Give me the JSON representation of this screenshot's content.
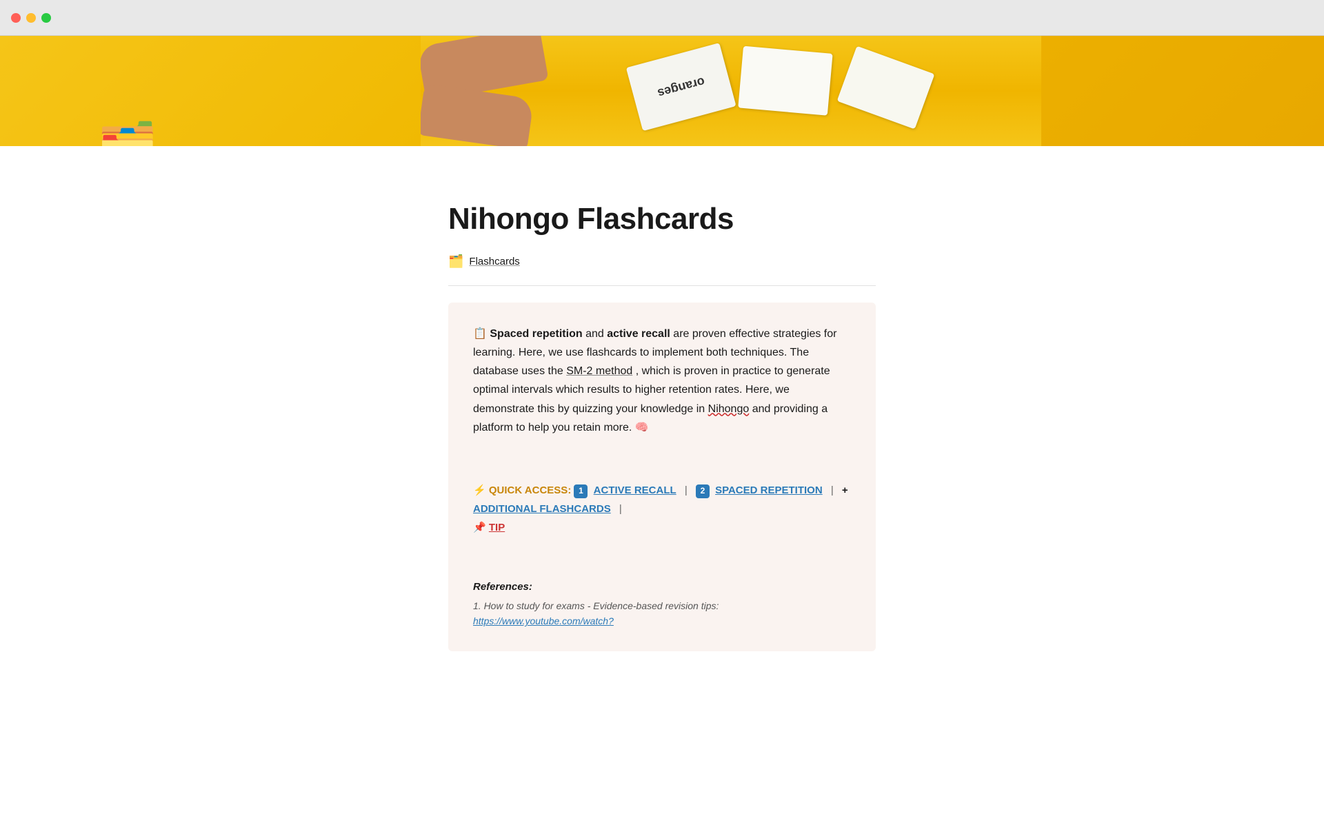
{
  "window": {
    "traffic_lights": [
      "close",
      "minimize",
      "maximize"
    ]
  },
  "hero": {
    "banner_alt": "Person holding flashcards over yellow background"
  },
  "page": {
    "icon": "🗂️",
    "title": "Nihongo Flashcards",
    "breadcrumb": {
      "icon": "🗂️",
      "label": "Flashcards"
    }
  },
  "info_box": {
    "intro_icon": "📋",
    "text_part1": " Spaced repetition and active recall are proven effective strategies for learning. Here, we use flashcards to implement both techniques. The database uses the ",
    "link_text": "SM-2 method",
    "text_part2": ", which is proven in practice to generate optimal intervals which results to higher retention rates. Here, we demonstrate this by quizzing your knowledge in Nihongo and providing a platform to help you retain more. 🧠",
    "quick_access": {
      "label_icon": "⚡",
      "label_text": "QUICK ACCESS:",
      "link1_number": "1️⃣",
      "link1_text": "ACTIVE RECALL",
      "separator1": "|",
      "link2_number": "2️⃣",
      "link2_text": "SPACED REPETITION",
      "separator2": "|",
      "link3_icon": "+",
      "link3_text": "ADDITIONAL FLASHCARDS",
      "separator3": "|",
      "link4_icon": "📌",
      "link4_text": "TIP"
    },
    "references": {
      "title": "References:",
      "items": [
        {
          "text": "1. How to study for exams - Evidence-based revision tips:",
          "link": "https://www.youtube.com/watch?"
        }
      ]
    }
  }
}
